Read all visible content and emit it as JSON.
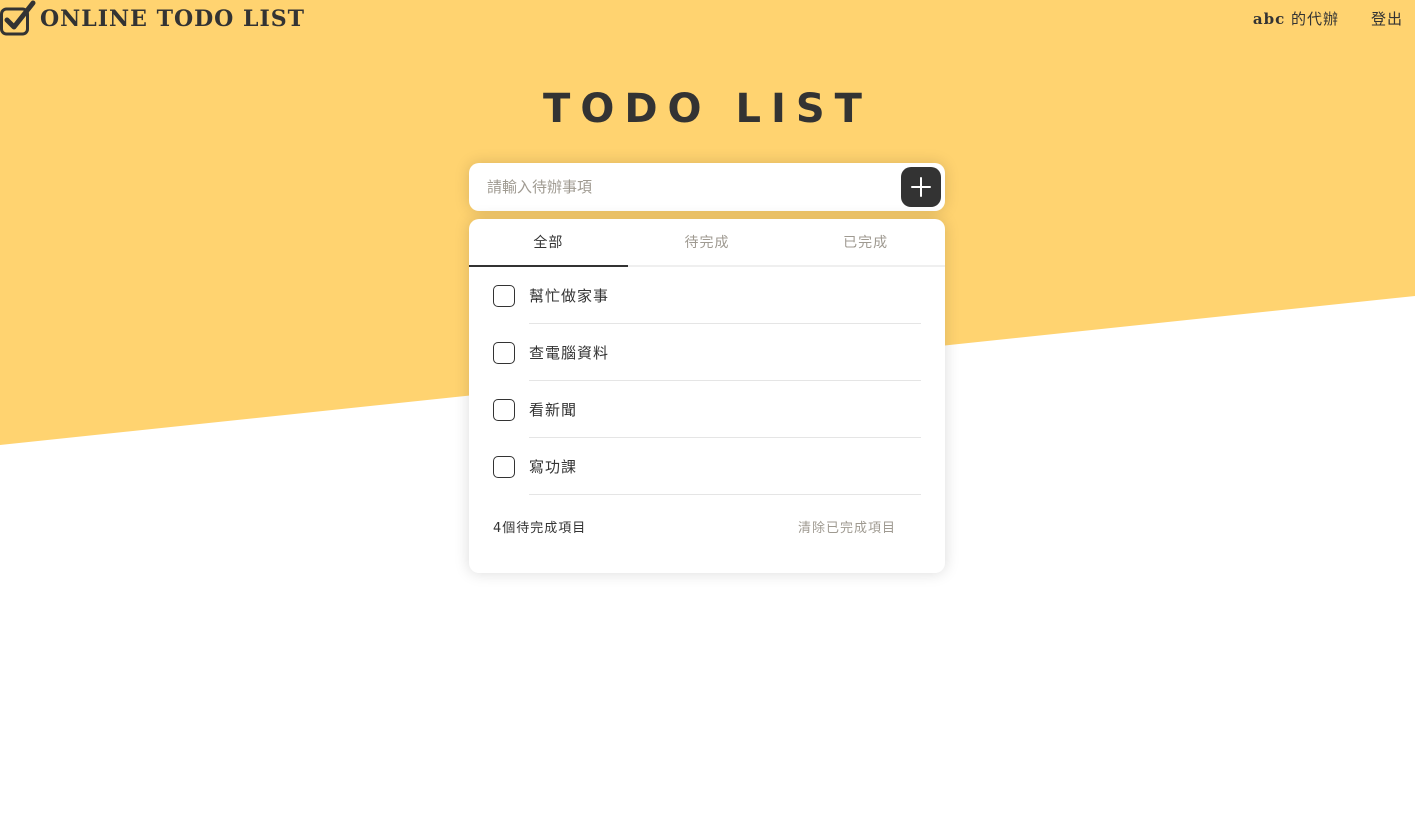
{
  "colors": {
    "accent": "#FFD370",
    "dark": "#333333",
    "muted": "#9F9A91"
  },
  "header": {
    "logo_text": "ONLINE TODO LIST",
    "logo_icon": "checkbox-check-icon",
    "user_name": "abc",
    "user_suffix": " 的代辦",
    "logout_label": "登出"
  },
  "main": {
    "title": "TODO LIST",
    "input": {
      "placeholder": "請輸入待辦事項",
      "value": ""
    },
    "add_icon": "plus-icon",
    "tabs": [
      {
        "label": "全部",
        "active": true
      },
      {
        "label": "待完成",
        "active": false
      },
      {
        "label": "已完成",
        "active": false
      }
    ],
    "items": [
      {
        "text": "幫忙做家事",
        "done": false
      },
      {
        "text": "查電腦資料",
        "done": false
      },
      {
        "text": "看新聞",
        "done": false
      },
      {
        "text": "寫功課",
        "done": false
      }
    ],
    "footer": {
      "count_text": "4個待完成項目",
      "clear_label": "清除已完成項目"
    }
  }
}
